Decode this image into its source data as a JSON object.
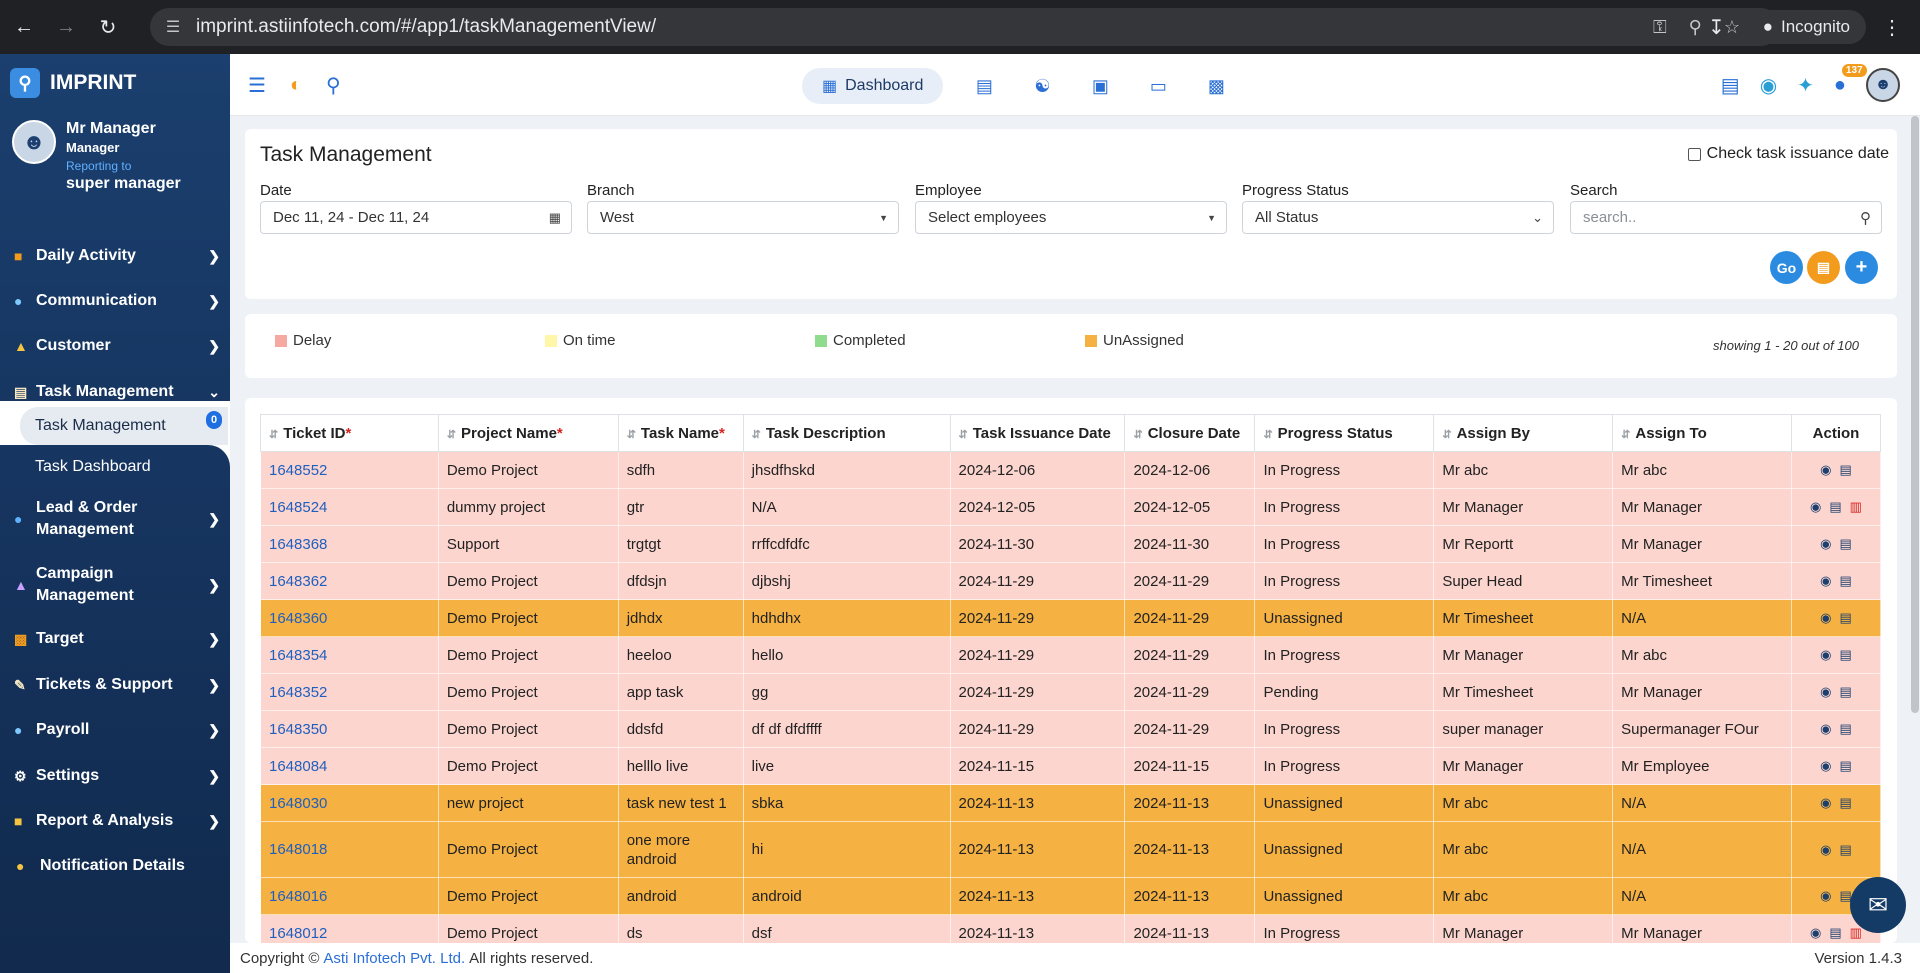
{
  "browser": {
    "url": "imprint.astiinfotech.com/#/app1/taskManagementView/",
    "profile_label": "Incognito"
  },
  "sidebar": {
    "brand": "IMPRINT",
    "user": {
      "name": "Mr Manager",
      "role": "Manager",
      "reporting_label": "Reporting to",
      "reporting_to": "super manager"
    },
    "menu": [
      {
        "label": "Daily Activity",
        "icon": "activity-icon"
      },
      {
        "label": "Communication",
        "icon": "chat-icon"
      },
      {
        "label": "Customer",
        "icon": "customer-icon"
      },
      {
        "label": "Task Management",
        "icon": "clipboard-icon"
      },
      {
        "label": "Lead & Order Management",
        "icon": "lead-icon"
      },
      {
        "label": "Campaign Management",
        "icon": "campaign-icon"
      },
      {
        "label": "Target",
        "icon": "target-icon"
      },
      {
        "label": "Tickets & Support",
        "icon": "ticket-icon"
      },
      {
        "label": "Payroll",
        "icon": "payroll-icon"
      },
      {
        "label": "Settings",
        "icon": "gear-icon"
      },
      {
        "label": "Report & Analysis",
        "icon": "report-icon"
      },
      {
        "label": "Notification Details",
        "icon": "bell-icon"
      }
    ],
    "submenu": {
      "active": "Task Management",
      "badge": "0",
      "second": "Task Dashboard"
    }
  },
  "topbar": {
    "dashboard_label": "Dashboard",
    "notification_count": "137"
  },
  "filters": {
    "title": "Task Management",
    "check_issuance_label": "Check task issuance date",
    "date_label": "Date",
    "date_value": "Dec 11, 24 - Dec 11, 24",
    "branch_label": "Branch",
    "branch_value": "West",
    "employee_label": "Employee",
    "employee_placeholder": "Select employees",
    "status_label": "Progress Status",
    "status_value": "All Status",
    "search_label": "Search",
    "search_placeholder": "search..",
    "go_label": "Go"
  },
  "legend": {
    "items": [
      {
        "label": "Delay",
        "color": "#f5a9a0"
      },
      {
        "label": "On time",
        "color": "#fff6a8"
      },
      {
        "label": "Completed",
        "color": "#8fdc8f"
      },
      {
        "label": "UnAssigned",
        "color": "#f5b141"
      }
    ],
    "showing": "showing 1 - 20 out of 100"
  },
  "table": {
    "headers": [
      "Ticket ID",
      "Project Name",
      "Task Name",
      "Task Description",
      "Task Issuance Date",
      "Closure Date",
      "Progress Status",
      "Assign By",
      "Assign To",
      "Action"
    ],
    "rows": [
      {
        "id": "1648552",
        "project": "Demo Project",
        "task": "sdfh",
        "desc": "jhsdfhskd",
        "issued": "2024-12-06",
        "closure": "2024-12-06",
        "status": "In Progress",
        "by": "Mr abc",
        "to": "Mr abc",
        "type": "delay"
      },
      {
        "id": "1648524",
        "project": "dummy project",
        "task": "gtr",
        "desc": "N/A",
        "issued": "2024-12-05",
        "closure": "2024-12-05",
        "status": "In Progress",
        "by": "Mr Manager",
        "to": "Mr Manager",
        "type": "delay"
      },
      {
        "id": "1648368",
        "project": "Support",
        "task": "trgtgt",
        "desc": "rrffcdfdfc",
        "issued": "2024-11-30",
        "closure": "2024-11-30",
        "status": "In Progress",
        "by": "Mr Reportt",
        "to": "Mr Manager",
        "type": "delay"
      },
      {
        "id": "1648362",
        "project": "Demo Project",
        "task": "dfdsjn",
        "desc": "djbshj",
        "issued": "2024-11-29",
        "closure": "2024-11-29",
        "status": "In Progress",
        "by": "Super Head",
        "to": "Mr Timesheet",
        "type": "delay"
      },
      {
        "id": "1648360",
        "project": "Demo Project",
        "task": "jdhdx",
        "desc": "hdhdhx",
        "issued": "2024-11-29",
        "closure": "2024-11-29",
        "status": "Unassigned",
        "by": "Mr Timesheet",
        "to": "N/A",
        "type": "unassigned"
      },
      {
        "id": "1648354",
        "project": "Demo Project",
        "task": "heeloo",
        "desc": "hello",
        "issued": "2024-11-29",
        "closure": "2024-11-29",
        "status": "In Progress",
        "by": "Mr Manager",
        "to": "Mr abc",
        "type": "delay"
      },
      {
        "id": "1648352",
        "project": "Demo Project",
        "task": "app task",
        "desc": "gg",
        "issued": "2024-11-29",
        "closure": "2024-11-29",
        "status": "Pending",
        "by": "Mr Timesheet",
        "to": "Mr Manager",
        "type": "delay"
      },
      {
        "id": "1648350",
        "project": "Demo Project",
        "task": "ddsfd",
        "desc": "df df dfdffff",
        "issued": "2024-11-29",
        "closure": "2024-11-29",
        "status": "In Progress",
        "by": "super manager",
        "to": "Supermanager FOur",
        "type": "delay"
      },
      {
        "id": "1648084",
        "project": "Demo Project",
        "task": "helllo live",
        "desc": "live",
        "issued": "2024-11-15",
        "closure": "2024-11-15",
        "status": "In Progress",
        "by": "Mr Manager",
        "to": "Mr Employee",
        "type": "delay"
      },
      {
        "id": "1648030",
        "project": "new project",
        "task": "task new test 1",
        "desc": "sbka",
        "issued": "2024-11-13",
        "closure": "2024-11-13",
        "status": "Unassigned",
        "by": "Mr abc",
        "to": "N/A",
        "type": "unassigned"
      },
      {
        "id": "1648018",
        "project": "Demo Project",
        "task": "one more android",
        "desc": "hi",
        "issued": "2024-11-13",
        "closure": "2024-11-13",
        "status": "Unassigned",
        "by": "Mr abc",
        "to": "N/A",
        "type": "unassigned"
      },
      {
        "id": "1648016",
        "project": "Demo Project",
        "task": "android",
        "desc": "android",
        "issued": "2024-11-13",
        "closure": "2024-11-13",
        "status": "Unassigned",
        "by": "Mr abc",
        "to": "N/A",
        "type": "unassigned"
      },
      {
        "id": "1648012",
        "project": "Demo Project",
        "task": "ds",
        "desc": "dsf",
        "issued": "2024-11-13",
        "closure": "2024-11-13",
        "status": "In Progress",
        "by": "Mr Manager",
        "to": "Mr Manager",
        "type": "delay"
      }
    ]
  },
  "footer": {
    "copyright": "Copyright ©",
    "company": "Asti Infotech Pvt. Ltd.",
    "rights": "All rights reserved.",
    "version": "Version 1.4.3"
  }
}
